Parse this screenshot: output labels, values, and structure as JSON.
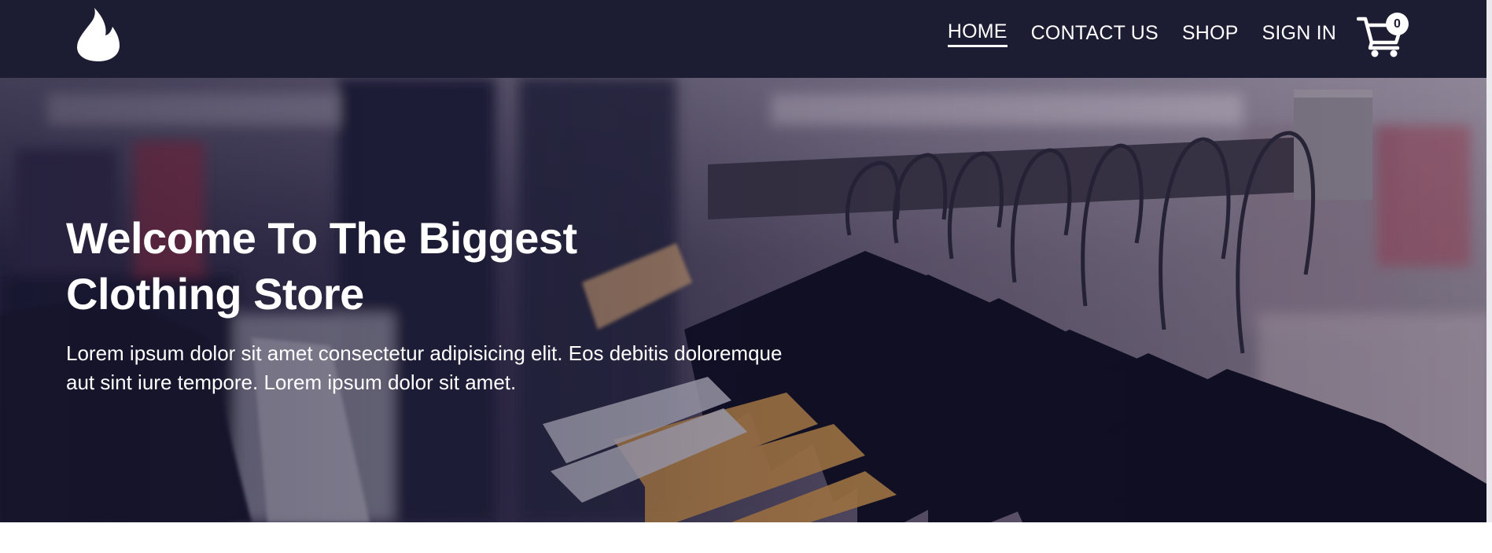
{
  "header": {
    "logo_icon": "flame-icon",
    "nav": [
      {
        "label": "HOME",
        "active": true
      },
      {
        "label": "CONTACT US",
        "active": false
      },
      {
        "label": "SHOP",
        "active": false
      },
      {
        "label": "SIGN IN",
        "active": false
      }
    ],
    "cart": {
      "icon": "cart-icon",
      "count": "0"
    }
  },
  "hero": {
    "title": "Welcome To The Biggest Clothing Store",
    "text": "Lorem ipsum dolor sit amet consectetur adipisicing elit. Eos debitis doloremque aut sint iure tempore. Lorem ipsum dolor sit amet.",
    "background": "clothing-rack-photo"
  },
  "colors": {
    "navbar_bg": "#1c1c33",
    "text": "#ffffff"
  }
}
